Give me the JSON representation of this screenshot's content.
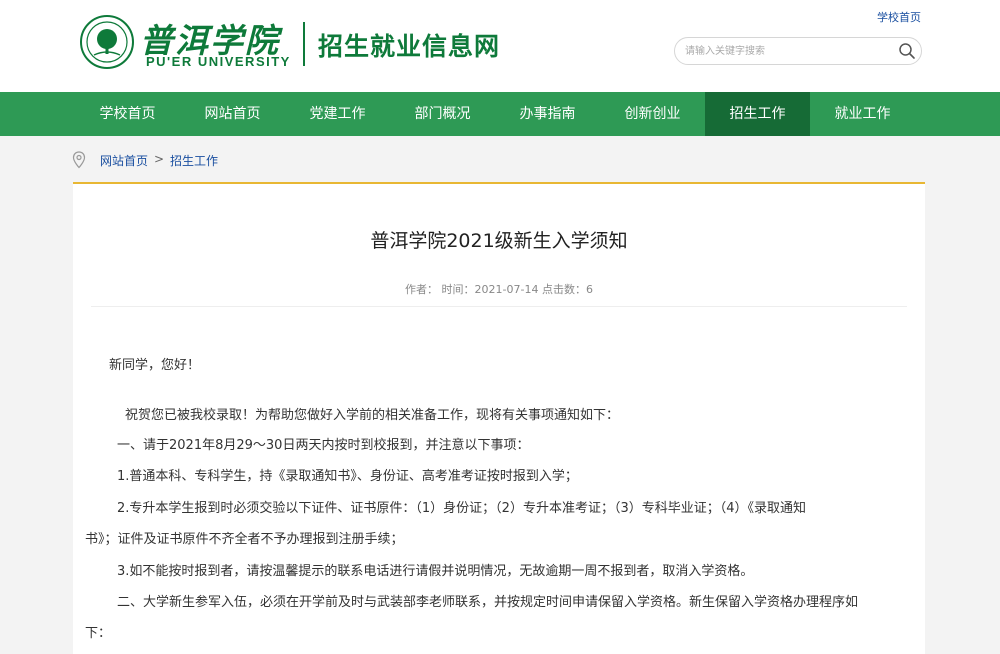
{
  "header": {
    "logo_cn": "普洱学院",
    "logo_en": "PU'ER UNIVERSITY",
    "site_title": "招生就业信息网",
    "top_link": "学校首页",
    "search_placeholder": "请输入关键字搜索"
  },
  "nav": {
    "items": [
      {
        "label": "学校首页"
      },
      {
        "label": "网站首页"
      },
      {
        "label": "党建工作"
      },
      {
        "label": "部门概况"
      },
      {
        "label": "办事指南"
      },
      {
        "label": "创新创业"
      },
      {
        "label": "招生工作",
        "active": true
      },
      {
        "label": "就业工作"
      }
    ]
  },
  "breadcrumb": {
    "home": "网站首页",
    "separator": ">",
    "current": "招生工作"
  },
  "article": {
    "title": "普洱学院2021级新生入学须知",
    "meta": "作者： 时间：2021-07-14 点击数：6",
    "paragraphs": [
      "新同学，您好！",
      "祝贺您已被我校录取！为帮助您做好入学前的相关准备工作，现将有关事项通知如下：",
      "一、请于2021年8月29～30日两天内按时到校报到，并注意以下事项：",
      "1.普通本科、专科学生，持《录取通知书》、身份证、高考准考证按时报到入学；",
      "2.专升本学生报到时必须交验以下证件、证书原件：（1）身份证；（2）专升本准考证；（3）专科毕业证；（4）《录取通知",
      "书》；证件及证书原件不齐全者不予办理报到注册手续；",
      "3.如不能按时报到者，请按温馨提示的联系电话进行请假并说明情况，无故逾期一周不报到者，取消入学资格。",
      "二、大学新生参军入伍，必须在开学前及时与武装部李老师联系，并按规定时间申请保留入学资格。新生保留入学资格办理程序如",
      "下："
    ]
  },
  "colors": {
    "brand_green": "#0e7a3a",
    "nav_green": "#2e9a55",
    "nav_active": "#166b36",
    "accent_gold": "#e8b733",
    "link_blue": "#1a4fa0"
  }
}
